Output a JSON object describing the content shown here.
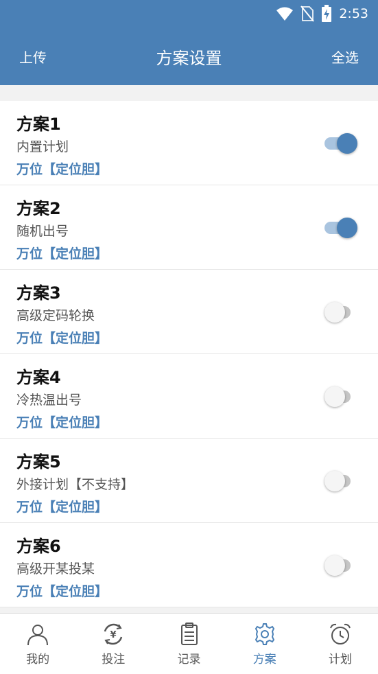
{
  "status_bar": {
    "time": "2:53"
  },
  "header": {
    "left_label": "上传",
    "title": "方案设置",
    "right_label": "全选"
  },
  "plans": [
    {
      "name": "方案1",
      "desc": "内置计划",
      "tag": "万位【定位胆】",
      "enabled": true
    },
    {
      "name": "方案2",
      "desc": "随机出号",
      "tag": "万位【定位胆】",
      "enabled": true
    },
    {
      "name": "方案3",
      "desc": "高级定码轮换",
      "tag": "万位【定位胆】",
      "enabled": false
    },
    {
      "name": "方案4",
      "desc": "冷热温出号",
      "tag": "万位【定位胆】",
      "enabled": false
    },
    {
      "name": "方案5",
      "desc": "外接计划【不支持】",
      "tag": "万位【定位胆】",
      "enabled": false
    },
    {
      "name": "方案6",
      "desc": "高级开某投某",
      "tag": "万位【定位胆】",
      "enabled": false
    }
  ],
  "nav": [
    {
      "label": "我的",
      "icon": "user-icon",
      "active": false
    },
    {
      "label": "投注",
      "icon": "yen-refresh-icon",
      "active": false
    },
    {
      "label": "记录",
      "icon": "clipboard-icon",
      "active": false
    },
    {
      "label": "方案",
      "icon": "gear-icon",
      "active": true
    },
    {
      "label": "计划",
      "icon": "alarm-clock-icon",
      "active": false
    }
  ],
  "colors": {
    "primary": "#4a80b6",
    "switch_on_track": "#a9c4df",
    "switch_off_thumb": "#f5f5f5"
  }
}
